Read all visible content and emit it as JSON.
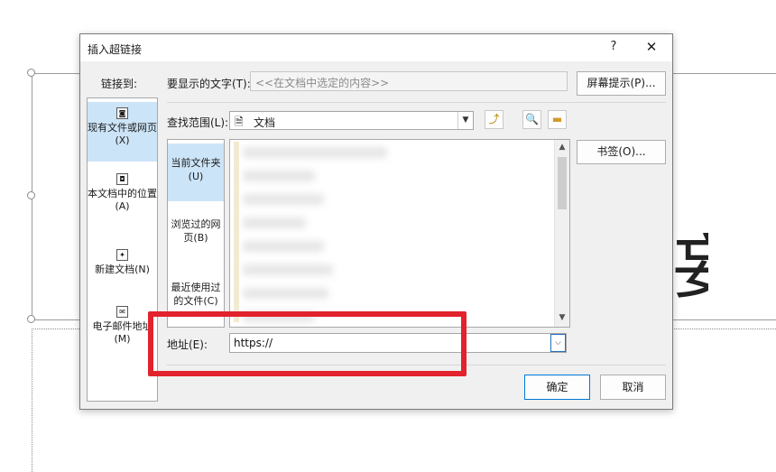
{
  "background": {
    "slide_text_fragment": "妄"
  },
  "dialog": {
    "title": "插入超链接",
    "help_glyph": "?",
    "close_glyph": "✕",
    "link_to_label": "链接到:",
    "sidebar": [
      {
        "label": "现有文件或网页(X)",
        "icon": "file-web-icon"
      },
      {
        "label": "本文档中的位置(A)",
        "icon": "document-place-icon"
      },
      {
        "label": "新建文档(N)",
        "icon": "new-document-icon"
      },
      {
        "label": "电子邮件地址(M)",
        "icon": "email-icon"
      }
    ],
    "display_text_label": "要显示的文字(T):",
    "display_text_value": "<<在文档中选定的内容>>",
    "screentip_button": "屏幕提示(P)...",
    "look_in_label": "查找范围(L):",
    "look_in_value": "文档",
    "bookmark_button": "书签(O)...",
    "subnav": [
      {
        "label": "当前文件夹(U)"
      },
      {
        "label": "浏览过的网页(B)"
      },
      {
        "label": "最近使用过的文件(C)"
      }
    ],
    "address_label": "地址(E):",
    "address_value": "https://",
    "ok_button": "确定",
    "cancel_button": "取消",
    "highlight_color": "#e2222d",
    "selection_color": "#cce4f7"
  }
}
